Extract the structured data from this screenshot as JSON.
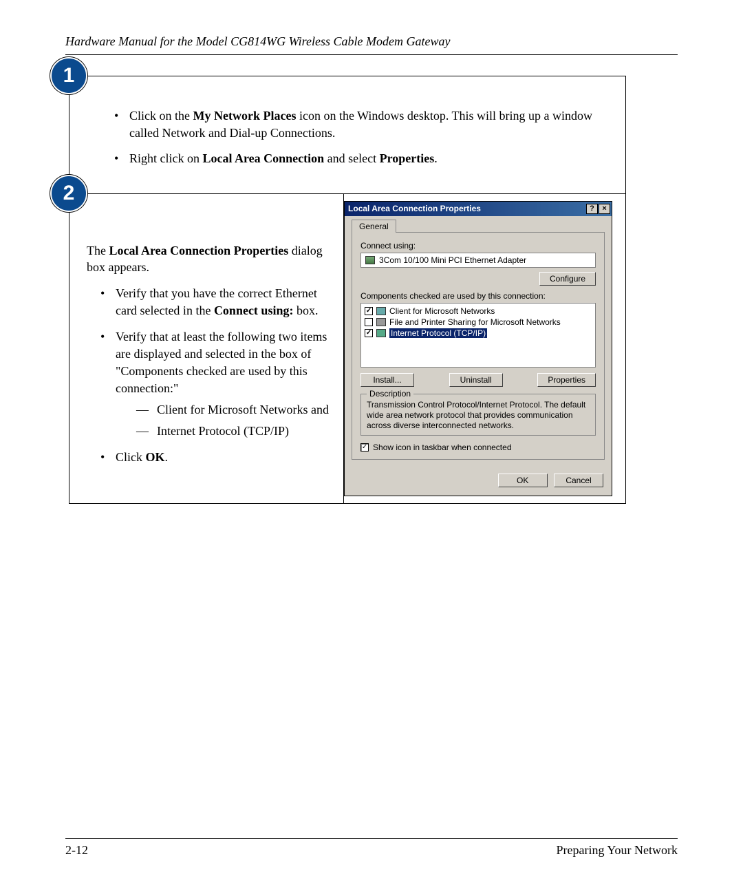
{
  "header": "Hardware Manual for the Model CG814WG Wireless Cable Modem Gateway",
  "step1": {
    "num": "1",
    "b1pre": "Click on the ",
    "b1bold": "My Network Places",
    "b1post": " icon on the Windows desktop.  This will bring up a window called Network and Dial-up Connections.",
    "b2pre": "Right click on ",
    "b2bold": "Local Area Connection",
    "b2mid": " and select ",
    "b2bold2": "Properties",
    "b2end": "."
  },
  "step2": {
    "num": "2",
    "intro_pre": "The ",
    "intro_bold": "Local Area Connection Properties",
    "intro_post": " dialog box appears.",
    "li1a": "Verify that you have the correct Ethernet card selected in the ",
    "li1bold": "Connect using:",
    "li1b": " box.",
    "li2": "Verify that at least the following two items are displayed and selected in the box of \"Components checked are used by this connection:\"",
    "sub1": "Client for Microsoft Networks and",
    "sub2": "Internet Protocol (TCP/IP)",
    "li3pre": "Click ",
    "li3bold": "OK",
    "li3post": "."
  },
  "dialog": {
    "title": "Local Area Connection Properties",
    "help": "?",
    "close": "×",
    "tab": "General",
    "connect_using": "Connect using:",
    "adapter": "3Com 10/100 Mini PCI Ethernet Adapter",
    "configure": "Configure",
    "components_label": "Components checked are used by this connection:",
    "comp1": "Client for Microsoft Networks",
    "comp2": "File and Printer Sharing for Microsoft Networks",
    "comp3": "Internet Protocol (TCP/IP)",
    "c1": "✓",
    "c2": "",
    "c3": "✓",
    "install": "Install...",
    "uninstall": "Uninstall",
    "properties": "Properties",
    "desc_label": "Description",
    "desc": "Transmission Control Protocol/Internet Protocol. The default wide area network protocol that provides communication across diverse interconnected networks.",
    "showicon": "Show icon in taskbar when connected",
    "showicon_check": "✓",
    "ok": "OK",
    "cancel": "Cancel"
  },
  "footer": {
    "left": "2-12",
    "right": "Preparing Your Network"
  }
}
